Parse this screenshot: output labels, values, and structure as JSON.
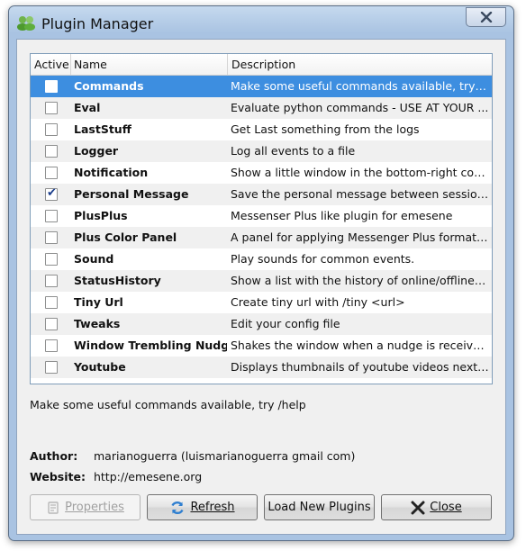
{
  "window": {
    "title": "Plugin Manager"
  },
  "columns": {
    "active": "Active",
    "name": "Name",
    "description": "Description"
  },
  "plugins": [
    {
      "name": "Commands",
      "description": "Make some useful commands available, try /help",
      "active": false,
      "selected": true
    },
    {
      "name": "Eval",
      "description": "Evaluate python commands - USE AT YOUR ...",
      "active": false
    },
    {
      "name": "LastStuff",
      "description": "Get Last something from the logs",
      "active": false
    },
    {
      "name": "Logger",
      "description": "Log all events to a file",
      "active": false
    },
    {
      "name": "Notification",
      "description": "Show a little window in the bottom-right corner ...",
      "active": false
    },
    {
      "name": "Personal Message",
      "description": "Save the personal message between sessions.",
      "active": true
    },
    {
      "name": "PlusPlus",
      "description": "Messenser Plus like plugin for emesene",
      "active": false
    },
    {
      "name": "Plus Color Panel",
      "description": "A panel for applying Messenger Plus formats t...",
      "active": false
    },
    {
      "name": "Sound",
      "description": "Play sounds for common events.",
      "active": false
    },
    {
      "name": "StatusHistory",
      "description": "Show a list with the history of online/offline eve...",
      "active": false
    },
    {
      "name": "Tiny Url",
      "description": "Create tiny url with /tiny <url>",
      "active": false
    },
    {
      "name": "Tweaks",
      "description": "Edit your config file",
      "active": false
    },
    {
      "name": "Window Trembling Nudge",
      "description": "Shakes the window when a nudge is received.",
      "active": false
    },
    {
      "name": "Youtube",
      "description": "Displays thumbnails of youtube videos next to l...",
      "active": false
    }
  ],
  "details": {
    "description": "Make some useful commands available, try /help",
    "author_label": "Author:",
    "author": "marianoguerra (luismarianoguerra gmail com)",
    "website_label": "Website:",
    "website": "http://emesene.org"
  },
  "buttons": {
    "properties": "Properties",
    "refresh": "Refresh",
    "load_new": "Load New Plugins",
    "close": "Close"
  },
  "colors": {
    "selection": "#3d8ee0",
    "title_bar": "#a9c3e2"
  }
}
